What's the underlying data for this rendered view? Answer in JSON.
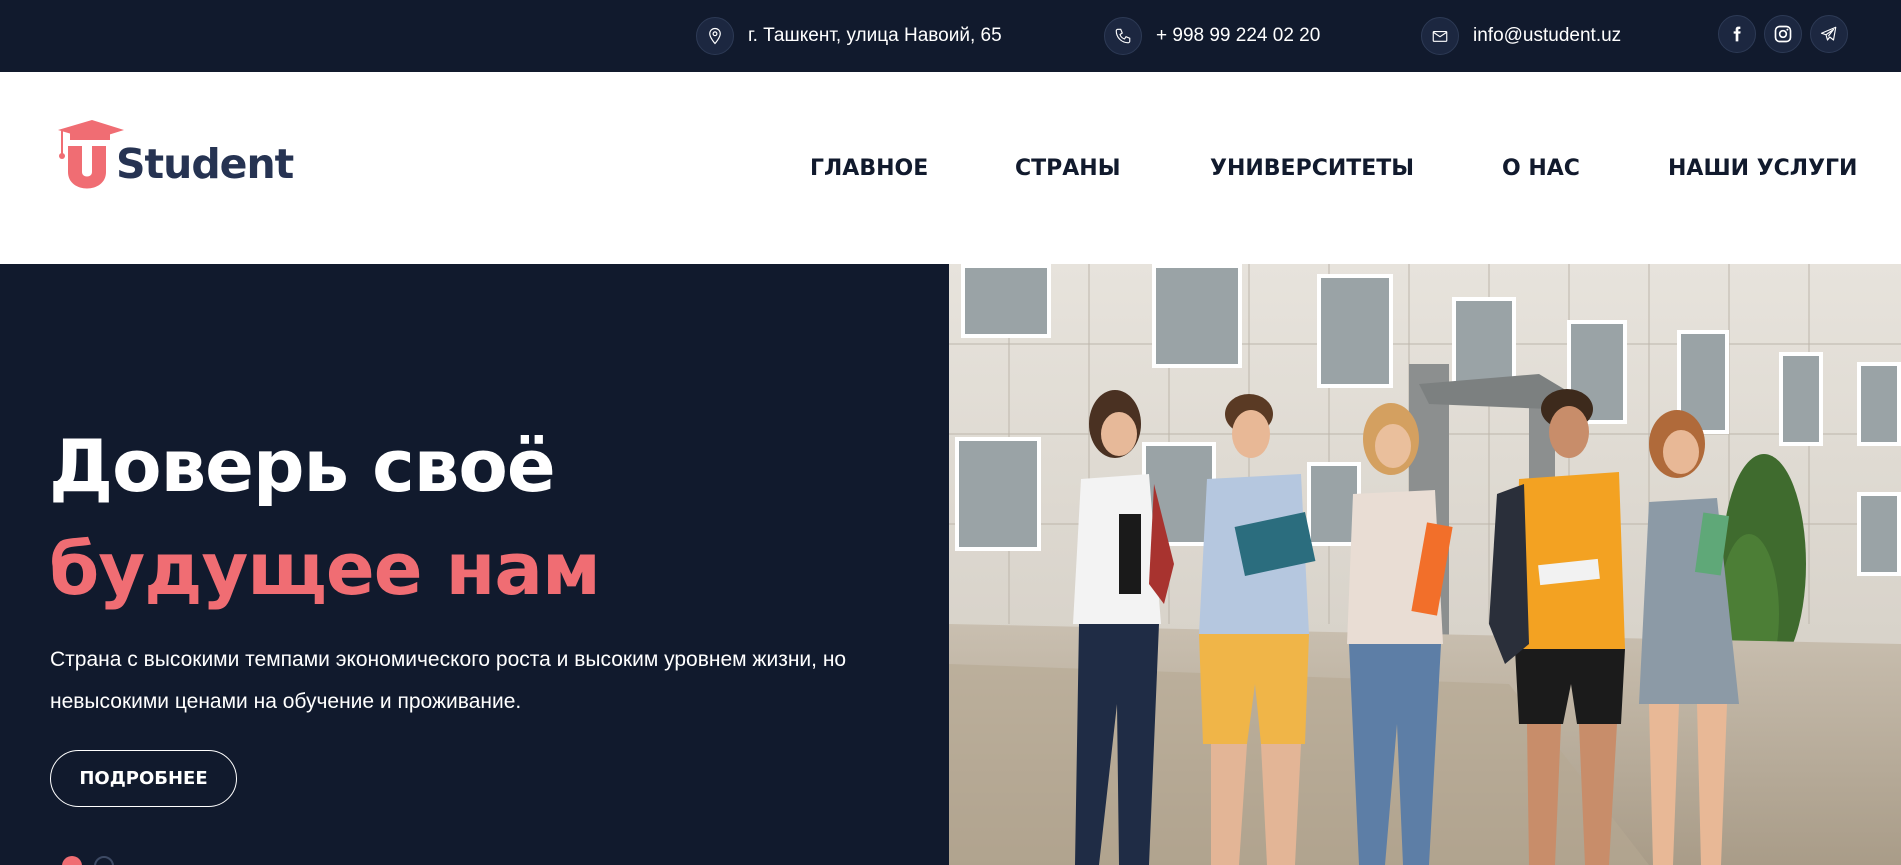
{
  "topbar": {
    "address": "г. Ташкент, улица Навоий, 65",
    "phone": "+ 998 99 224 02 20",
    "email": "info@ustudent.uz",
    "icons": [
      "location-pin-icon",
      "phone-icon",
      "mail-icon",
      "facebook-icon",
      "instagram-icon",
      "telegram-icon"
    ]
  },
  "logo": {
    "text": "Student"
  },
  "nav": {
    "items": [
      {
        "label": "ГЛАВНОЕ"
      },
      {
        "label": "СТРАНЫ"
      },
      {
        "label": "УНИВЕРСИТЕТЫ"
      },
      {
        "label": "О НАС"
      },
      {
        "label": "НАШИ УСЛУГИ"
      }
    ]
  },
  "hero": {
    "title_line1": "Доверь своё",
    "title_line2": "будущее нам",
    "text": "Страна с высокими темпами экономического роста и высоким уровнем жизни, но невысокими ценами на обучение и проживание.",
    "button": "ПОДРОБНЕЕ",
    "slides_total": 2,
    "active_slide": 1
  },
  "colors": {
    "navy": "#111a2d",
    "accent": "#f06d73",
    "logo_text": "#263352"
  }
}
